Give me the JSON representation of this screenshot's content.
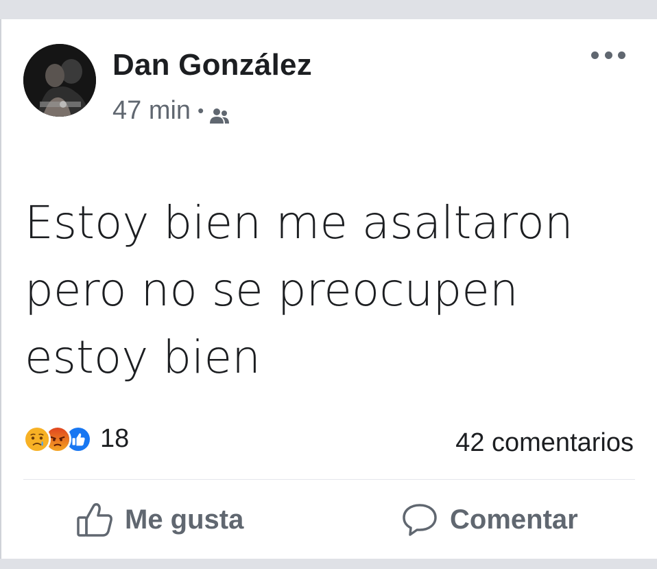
{
  "post": {
    "author": "Dan González",
    "time": "47 min",
    "separator": "•",
    "audience_icon": "friends-icon",
    "more_icon": "more-options-icon",
    "text": "Estoy bien me asaltaron pero no se preocupen estoy bien"
  },
  "stats": {
    "reactions": [
      "sad",
      "angry",
      "like"
    ],
    "reaction_count": "18",
    "comments": "42 comentarios"
  },
  "actions": {
    "like_label": "Me gusta",
    "comment_label": "Comentar"
  },
  "colors": {
    "text": "#1c1e21",
    "secondary": "#606770",
    "like_blue": "#1877f2",
    "angry_red": "#e9710f",
    "sad_yellow": "#f7b125"
  }
}
